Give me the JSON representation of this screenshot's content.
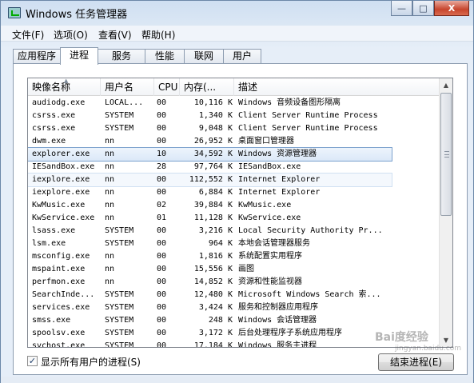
{
  "window": {
    "title": "Windows 任务管理器",
    "minimize_label": "—",
    "maximize_label": "□",
    "close_label": "X"
  },
  "menu": {
    "items": [
      "文件(F)",
      "选项(O)",
      "查看(V)",
      "帮助(H)"
    ]
  },
  "tabs": {
    "items": [
      "应用程序",
      "进程",
      "服务",
      "性能",
      "联网",
      "用户"
    ],
    "active": "进程"
  },
  "table": {
    "columns": [
      "映像名称",
      "用户名",
      "CPU",
      "内存(...",
      "描述"
    ],
    "sort_column": "映像名称",
    "rows": [
      {
        "name": "audiodg.exe",
        "user": "LOCAL...",
        "cpu": "00",
        "mem": "10,116 K",
        "desc": "Windows 音频设备图形隔离"
      },
      {
        "name": "csrss.exe",
        "user": "SYSTEM",
        "cpu": "00",
        "mem": "1,340 K",
        "desc": "Client Server Runtime Process"
      },
      {
        "name": "csrss.exe",
        "user": "SYSTEM",
        "cpu": "00",
        "mem": "9,048 K",
        "desc": "Client Server Runtime Process"
      },
      {
        "name": "dwm.exe",
        "user": "nn",
        "cpu": "00",
        "mem": "26,952 K",
        "desc": "桌面窗口管理器"
      },
      {
        "name": "explorer.exe",
        "user": "nn",
        "cpu": "10",
        "mem": "34,592 K",
        "desc": "Windows 资源管理器"
      },
      {
        "name": "IESandBox.exe",
        "user": "nn",
        "cpu": "28",
        "mem": "97,764 K",
        "desc": "IESandBox.exe"
      },
      {
        "name": "iexplore.exe",
        "user": "nn",
        "cpu": "00",
        "mem": "112,552 K",
        "desc": "Internet Explorer"
      },
      {
        "name": "iexplore.exe",
        "user": "nn",
        "cpu": "00",
        "mem": "6,884 K",
        "desc": "Internet Explorer"
      },
      {
        "name": "KwMusic.exe",
        "user": "nn",
        "cpu": "02",
        "mem": "39,884 K",
        "desc": "KwMusic.exe"
      },
      {
        "name": "KwService.exe",
        "user": "nn",
        "cpu": "01",
        "mem": "11,128 K",
        "desc": "KwService.exe"
      },
      {
        "name": "lsass.exe",
        "user": "SYSTEM",
        "cpu": "00",
        "mem": "3,216 K",
        "desc": "Local Security Authority Pr..."
      },
      {
        "name": "lsm.exe",
        "user": "SYSTEM",
        "cpu": "00",
        "mem": "964 K",
        "desc": "本地会话管理器服务"
      },
      {
        "name": "msconfig.exe",
        "user": "nn",
        "cpu": "00",
        "mem": "1,816 K",
        "desc": "系统配置实用程序"
      },
      {
        "name": "mspaint.exe",
        "user": "nn",
        "cpu": "00",
        "mem": "15,556 K",
        "desc": "画图"
      },
      {
        "name": "perfmon.exe",
        "user": "nn",
        "cpu": "00",
        "mem": "14,852 K",
        "desc": "资源和性能监视器"
      },
      {
        "name": "SearchInde...",
        "user": "SYSTEM",
        "cpu": "00",
        "mem": "12,480 K",
        "desc": "Microsoft Windows Search 索..."
      },
      {
        "name": "services.exe",
        "user": "SYSTEM",
        "cpu": "00",
        "mem": "3,424 K",
        "desc": "服务和控制器应用程序"
      },
      {
        "name": "smss.exe",
        "user": "SYSTEM",
        "cpu": "00",
        "mem": "248 K",
        "desc": "Windows 会话管理器"
      },
      {
        "name": "spoolsv.exe",
        "user": "SYSTEM",
        "cpu": "00",
        "mem": "3,172 K",
        "desc": "后台处理程序子系统应用程序"
      },
      {
        "name": "svchost.exe",
        "user": "SYSTEM",
        "cpu": "00",
        "mem": "17,184 K",
        "desc": "Windows 服务主进程"
      }
    ],
    "selected_row": "explorer.exe",
    "hover_row": "iexplore.exe"
  },
  "footer": {
    "show_all_label": "显示所有用户的进程(S)",
    "show_all_checked": true,
    "end_process_label": "结束进程(E)"
  },
  "watermark": {
    "text": "Bai度经验",
    "sub": "jingyan.baidu.com"
  }
}
